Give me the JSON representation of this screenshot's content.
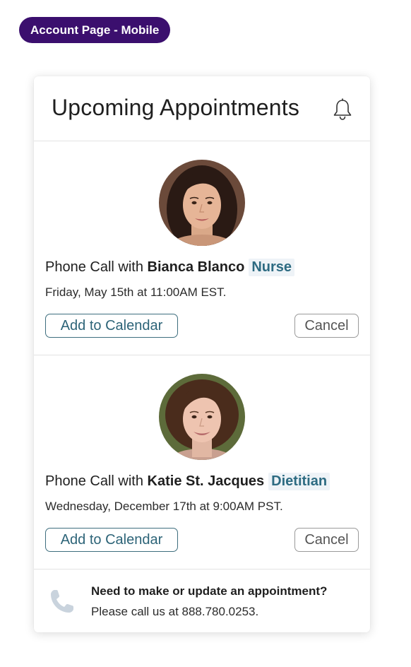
{
  "page_tag": "Account Page - Mobile",
  "card": {
    "title": "Upcoming Appointments",
    "bell_icon": "bell-icon"
  },
  "appointments": [
    {
      "prefix": "Phone Call with",
      "name": "Bianca Blanco",
      "role": "Nurse",
      "when": "Friday, May 15th at 11:00AM EST.",
      "add_label": "Add to Calendar",
      "cancel_label": "Cancel"
    },
    {
      "prefix": "Phone Call with",
      "name": "Katie St. Jacques",
      "role": "Dietitian",
      "when": "Wednesday, December 17th at 9:00AM PST.",
      "add_label": "Add to Calendar",
      "cancel_label": "Cancel"
    }
  ],
  "footer": {
    "icon": "phone-icon",
    "title": "Need to make or update an appointment?",
    "text": "Please call us at 888.780.0253."
  },
  "colors": {
    "tag_background": "#3b0f6e",
    "accent": "#2d6b82",
    "role_background": "#eef3f7"
  }
}
